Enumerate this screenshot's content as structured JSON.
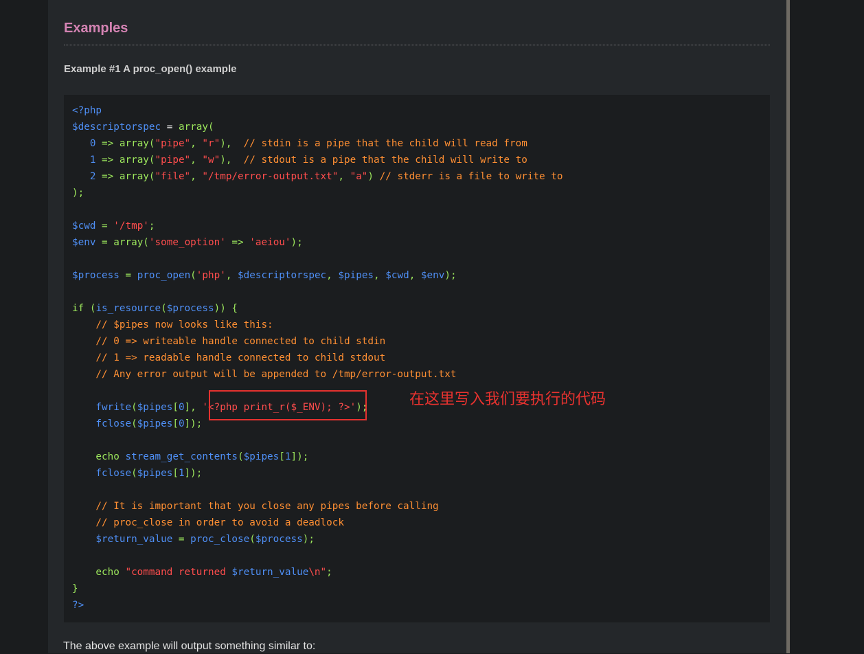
{
  "section": {
    "title": "Examples",
    "example_title": "Example #1 A proc_open() example",
    "outro": "The above example will output something similar to:"
  },
  "code": {
    "lines": [
      [
        {
          "t": "<?php",
          "c": "v"
        }
      ],
      [
        {
          "t": "$descriptorspec",
          "c": "v"
        },
        {
          "t": " = ",
          "c": "p"
        },
        {
          "t": "array(",
          "c": "k"
        }
      ],
      [
        {
          "t": "   0 ",
          "c": "v"
        },
        {
          "t": "=> array(",
          "c": "k"
        },
        {
          "t": "\"pipe\"",
          "c": "s"
        },
        {
          "t": ", ",
          "c": "k"
        },
        {
          "t": "\"r\"",
          "c": "s"
        },
        {
          "t": "),  ",
          "c": "k"
        },
        {
          "t": "// stdin is a pipe that the child will read from",
          "c": "c"
        }
      ],
      [
        {
          "t": "   1 ",
          "c": "v"
        },
        {
          "t": "=> array(",
          "c": "k"
        },
        {
          "t": "\"pipe\"",
          "c": "s"
        },
        {
          "t": ", ",
          "c": "k"
        },
        {
          "t": "\"w\"",
          "c": "s"
        },
        {
          "t": "),  ",
          "c": "k"
        },
        {
          "t": "// stdout is a pipe that the child will write to",
          "c": "c"
        }
      ],
      [
        {
          "t": "   2 ",
          "c": "v"
        },
        {
          "t": "=> array(",
          "c": "k"
        },
        {
          "t": "\"file\"",
          "c": "s"
        },
        {
          "t": ", ",
          "c": "k"
        },
        {
          "t": "\"/tmp/error-output.txt\"",
          "c": "s"
        },
        {
          "t": ", ",
          "c": "k"
        },
        {
          "t": "\"a\"",
          "c": "s"
        },
        {
          "t": ") ",
          "c": "k"
        },
        {
          "t": "// stderr is a file to write to",
          "c": "c"
        }
      ],
      [
        {
          "t": ");",
          "c": "k"
        }
      ],
      [],
      [
        {
          "t": "$cwd",
          "c": "v"
        },
        {
          "t": " = ",
          "c": "k"
        },
        {
          "t": "'/tmp'",
          "c": "s"
        },
        {
          "t": ";",
          "c": "k"
        }
      ],
      [
        {
          "t": "$env",
          "c": "v"
        },
        {
          "t": " = ",
          "c": "k"
        },
        {
          "t": "array(",
          "c": "k"
        },
        {
          "t": "'some_option'",
          "c": "s"
        },
        {
          "t": " => ",
          "c": "k"
        },
        {
          "t": "'aeiou'",
          "c": "s"
        },
        {
          "t": ");",
          "c": "k"
        }
      ],
      [],
      [
        {
          "t": "$process",
          "c": "v"
        },
        {
          "t": " = ",
          "c": "k"
        },
        {
          "t": "proc_open",
          "c": "v"
        },
        {
          "t": "(",
          "c": "k"
        },
        {
          "t": "'php'",
          "c": "s"
        },
        {
          "t": ", ",
          "c": "k"
        },
        {
          "t": "$descriptorspec",
          "c": "v"
        },
        {
          "t": ", ",
          "c": "k"
        },
        {
          "t": "$pipes",
          "c": "v"
        },
        {
          "t": ", ",
          "c": "k"
        },
        {
          "t": "$cwd",
          "c": "v"
        },
        {
          "t": ", ",
          "c": "k"
        },
        {
          "t": "$env",
          "c": "v"
        },
        {
          "t": ");",
          "c": "k"
        }
      ],
      [],
      [
        {
          "t": "if (",
          "c": "k"
        },
        {
          "t": "is_resource",
          "c": "v"
        },
        {
          "t": "(",
          "c": "k"
        },
        {
          "t": "$process",
          "c": "v"
        },
        {
          "t": ")) {",
          "c": "k"
        }
      ],
      [
        {
          "t": "    // $pipes now looks like this:",
          "c": "c"
        }
      ],
      [
        {
          "t": "    // 0 => writeable handle connected to child stdin",
          "c": "c"
        }
      ],
      [
        {
          "t": "    // 1 => readable handle connected to child stdout",
          "c": "c"
        }
      ],
      [
        {
          "t": "    // Any error output will be appended to /tmp/error-output.txt",
          "c": "c"
        }
      ],
      [],
      [
        {
          "t": "    fwrite",
          "c": "v"
        },
        {
          "t": "(",
          "c": "k"
        },
        {
          "t": "$pipes",
          "c": "v"
        },
        {
          "t": "[",
          "c": "k"
        },
        {
          "t": "0",
          "c": "v"
        },
        {
          "t": "], ",
          "c": "k"
        },
        {
          "t": "'<?php print_r($_ENV); ?>'",
          "c": "s"
        },
        {
          "t": ");",
          "c": "k"
        }
      ],
      [
        {
          "t": "    fclose",
          "c": "v"
        },
        {
          "t": "(",
          "c": "k"
        },
        {
          "t": "$pipes",
          "c": "v"
        },
        {
          "t": "[",
          "c": "k"
        },
        {
          "t": "0",
          "c": "v"
        },
        {
          "t": "]);",
          "c": "k"
        }
      ],
      [],
      [
        {
          "t": "    echo ",
          "c": "k"
        },
        {
          "t": "stream_get_contents",
          "c": "v"
        },
        {
          "t": "(",
          "c": "k"
        },
        {
          "t": "$pipes",
          "c": "v"
        },
        {
          "t": "[",
          "c": "k"
        },
        {
          "t": "1",
          "c": "v"
        },
        {
          "t": "]);",
          "c": "k"
        }
      ],
      [
        {
          "t": "    fclose",
          "c": "v"
        },
        {
          "t": "(",
          "c": "k"
        },
        {
          "t": "$pipes",
          "c": "v"
        },
        {
          "t": "[",
          "c": "k"
        },
        {
          "t": "1",
          "c": "v"
        },
        {
          "t": "]);",
          "c": "k"
        }
      ],
      [],
      [
        {
          "t": "    // It is important that you close any pipes before calling",
          "c": "c"
        }
      ],
      [
        {
          "t": "    // proc_close in order to avoid a deadlock",
          "c": "c"
        }
      ],
      [
        {
          "t": "    $return_value",
          "c": "v"
        },
        {
          "t": " = ",
          "c": "k"
        },
        {
          "t": "proc_close",
          "c": "v"
        },
        {
          "t": "(",
          "c": "k"
        },
        {
          "t": "$process",
          "c": "v"
        },
        {
          "t": ");",
          "c": "k"
        }
      ],
      [],
      [
        {
          "t": "    echo ",
          "c": "k"
        },
        {
          "t": "\"command returned ",
          "c": "s"
        },
        {
          "t": "$return_value",
          "c": "v"
        },
        {
          "t": "\\n\"",
          "c": "s"
        },
        {
          "t": ";",
          "c": "k"
        }
      ],
      [
        {
          "t": "}",
          "c": "k"
        }
      ],
      [
        {
          "t": "?>",
          "c": "v"
        }
      ]
    ]
  },
  "annotation": {
    "text": "在这里写入我们要执行的代码",
    "color": "#e8322f"
  },
  "colors": {
    "heading": "#d483b3",
    "variable": "#4f8ff5",
    "string": "#ff4d4d",
    "keyword": "#9ce65c",
    "comment": "#ff8f33"
  }
}
